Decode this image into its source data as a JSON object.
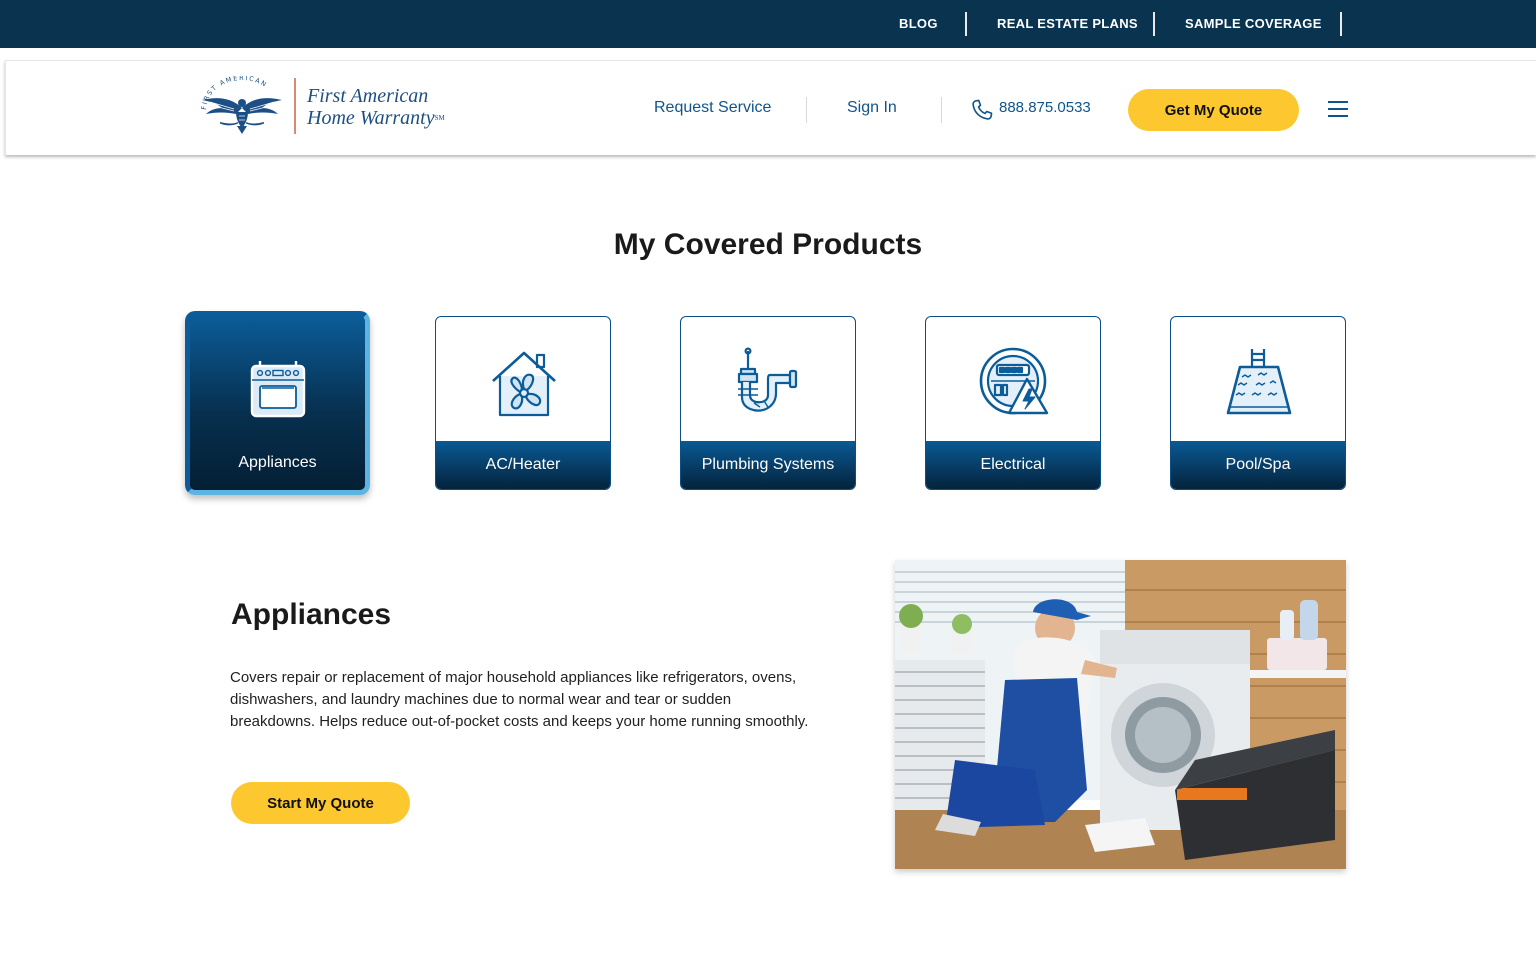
{
  "topbar": {
    "links": [
      "BLOG",
      "REAL ESTATE PLANS",
      "SAMPLE COVERAGE"
    ]
  },
  "header": {
    "logo_line1": "First American",
    "logo_line2": "Home Warranty",
    "logo_mark": "SM",
    "logo_seal_text": "FIRST AMERICAN",
    "nav": {
      "request_service": "Request Service",
      "sign_in": "Sign In",
      "phone": "888.875.0533"
    },
    "quote_button": "Get My Quote",
    "menu_icon": "hamburger-menu-icon"
  },
  "products": {
    "title": "My Covered Products",
    "active_index": 0,
    "items": [
      {
        "label": "Appliances",
        "icon": "oven-icon"
      },
      {
        "label": "AC/Heater",
        "icon": "house-fan-icon"
      },
      {
        "label": "Plumbing Systems",
        "icon": "pipe-icon"
      },
      {
        "label": "Electrical",
        "icon": "electric-meter-icon"
      },
      {
        "label": "Pool/Spa",
        "icon": "pool-icon"
      }
    ]
  },
  "detail": {
    "title": "Appliances",
    "description": "Covers repair or replacement of major household appliances like refrigerators, ovens, dishwashers, and laundry machines due to normal wear and tear or sudden breakdowns. Helps reduce out-of-pocket costs and keeps your home running smoothly.",
    "button": "Start My Quote",
    "image_alt": "technician repairing a washing machine"
  },
  "colors": {
    "navy": "#0a3350",
    "brand_blue": "#11548a",
    "accent_yellow": "#fdc82f",
    "active_border": "#5eb4e0"
  }
}
